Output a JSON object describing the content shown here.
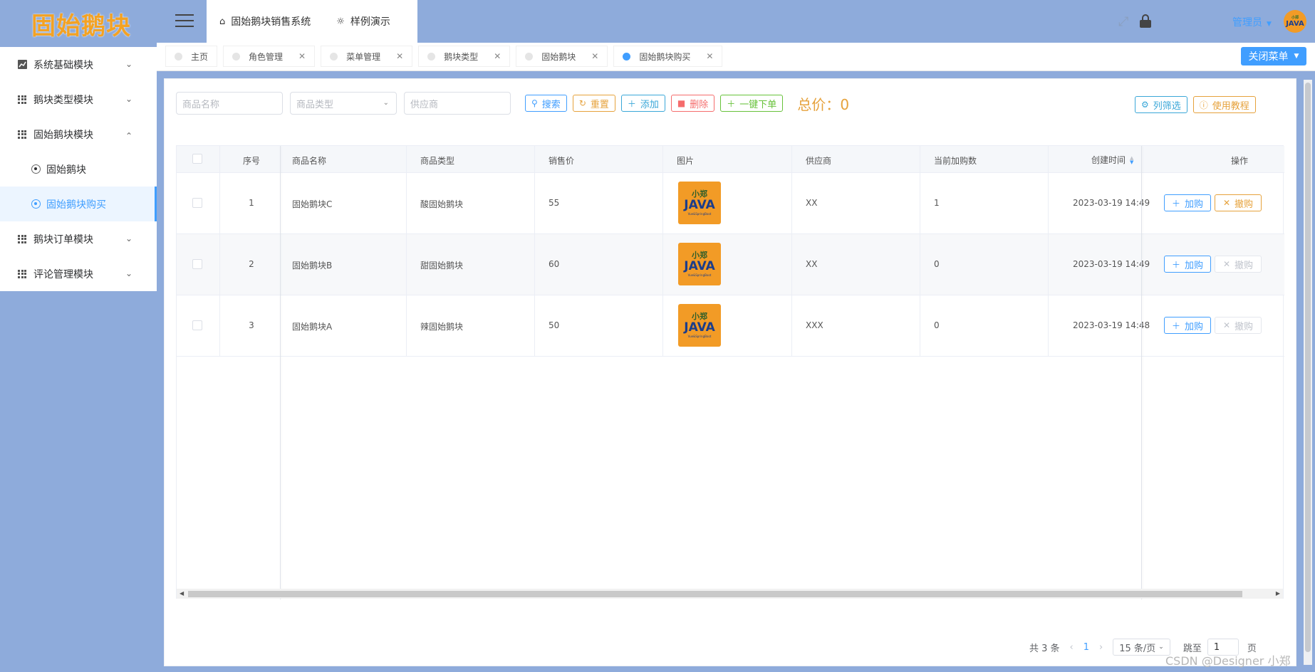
{
  "brand": {
    "logo_text": "固始鹅块"
  },
  "sidebar": {
    "items": [
      {
        "label": "系统基础模块"
      },
      {
        "label": "鹅块类型模块"
      },
      {
        "label": "固始鹅块模块"
      },
      {
        "label": "鹅块订单模块"
      },
      {
        "label": "评论管理模块"
      }
    ],
    "sub_items": [
      {
        "label": "固始鹅块"
      },
      {
        "label": "固始鹅块购买"
      }
    ]
  },
  "header": {
    "tabs": [
      {
        "label": "固始鹅块销售系统"
      },
      {
        "label": "样例演示"
      }
    ],
    "user": "管理员",
    "avatar_small": "小郑",
    "avatar_big": "JAVA"
  },
  "tagbar": {
    "tags": [
      {
        "label": "主页"
      },
      {
        "label": "角色管理"
      },
      {
        "label": "菜单管理"
      },
      {
        "label": "鹅块类型"
      },
      {
        "label": "固始鹅块"
      },
      {
        "label": "固始鹅块购买"
      }
    ],
    "close_menu": "关闭菜单"
  },
  "toolbar": {
    "name_placeholder": "商品名称",
    "type_placeholder": "商品类型",
    "supplier_placeholder": "供应商",
    "search": "搜索",
    "reset": "重置",
    "add": "添加",
    "delete": "删除",
    "one_click_order": "一键下单",
    "total_label": "总价：",
    "total_value": "0",
    "column_filter": "列筛选",
    "tutorial": "使用教程"
  },
  "table": {
    "headers": {
      "index": "序号",
      "name": "商品名称",
      "type": "商品类型",
      "price": "销售价",
      "image": "图片",
      "supplier": "供应商",
      "count": "当前加购数",
      "created": "创建时间",
      "actions": "操作"
    },
    "rows": [
      {
        "index": "1",
        "name": "固始鹅块C",
        "type": "酸固始鹅块",
        "price": "55",
        "supplier": "XX",
        "count": "1",
        "created": "2023-03-19 14:49"
      },
      {
        "index": "2",
        "name": "固始鹅块B",
        "type": "甜固始鹅块",
        "price": "60",
        "supplier": "XX",
        "count": "0",
        "created": "2023-03-19 14:49"
      },
      {
        "index": "3",
        "name": "固始鹅块A",
        "type": "辣固始鹅块",
        "price": "50",
        "supplier": "XXX",
        "count": "0",
        "created": "2023-03-19 14:48"
      }
    ],
    "thumb_top": "小郑",
    "thumb_main": "JAVA",
    "thumb_sub": "Vue&SpringBoot",
    "add_cart": "加购",
    "cancel": "撤购",
    "row_cancel_enabled": [
      true,
      false,
      false
    ]
  },
  "pagination": {
    "total": "共 3 条",
    "current_page": "1",
    "page_size": "15 条/页",
    "jump_label": "跳至",
    "jump_value": "1",
    "page_suffix": "页"
  },
  "watermark": "CSDN @Designer 小郑",
  "colors": {
    "sidebar_bg": "#8eabdb",
    "primary": "#409eff",
    "warning": "#e6a23c",
    "danger": "#f56c6c",
    "success": "#67c23a"
  }
}
